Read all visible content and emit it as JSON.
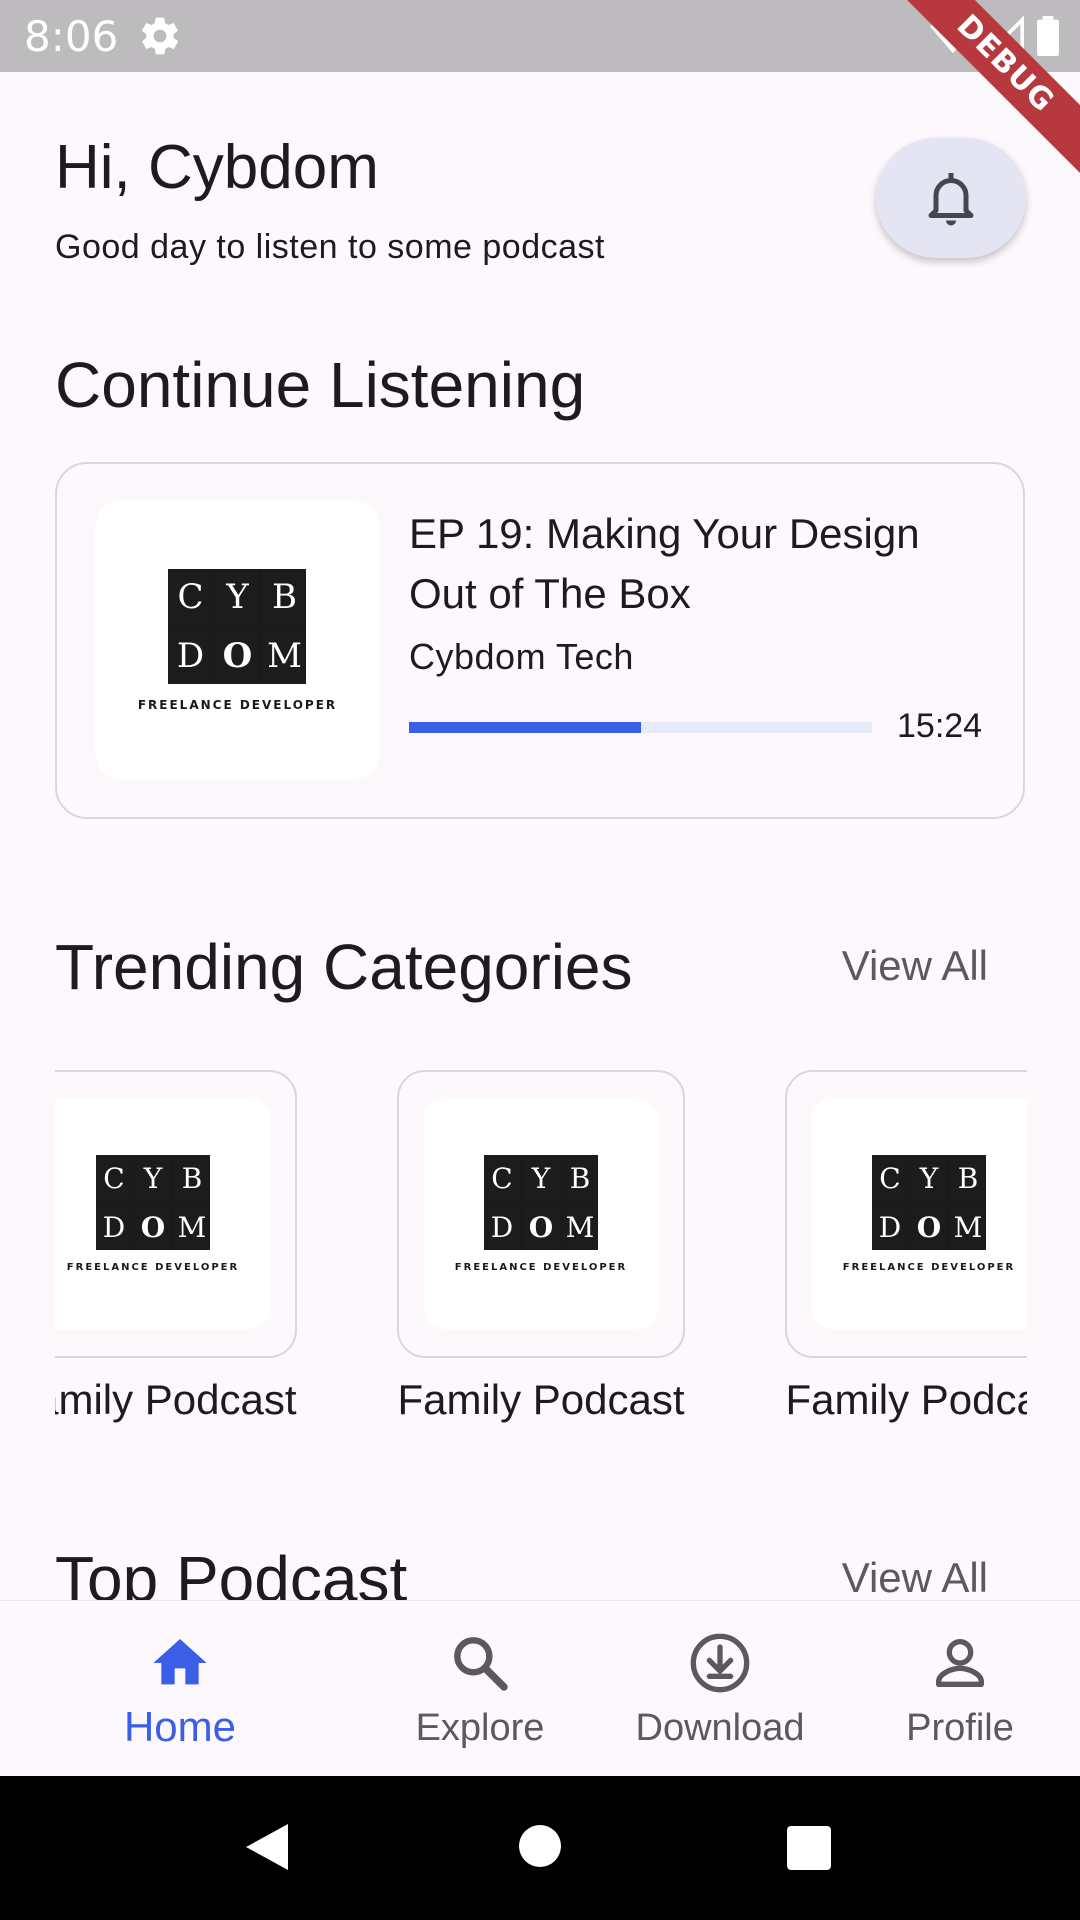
{
  "status_bar": {
    "time": "8:06",
    "debug_label": "DEBUG"
  },
  "header": {
    "greeting": "Hi, Cybdom",
    "subtitle": "Good day to listen to some podcast"
  },
  "continue_listening": {
    "title": "Continue Listening",
    "episode_title": "EP 19: Making Your Design Out of The Box",
    "author": "Cybdom Tech",
    "progress": 0.5,
    "time": "15:24"
  },
  "logo": {
    "cells": [
      "C",
      "Y",
      "B",
      "D",
      "O",
      "M"
    ],
    "subtitle": "FREELANCE DEVELOPER"
  },
  "trending": {
    "title": "Trending Categories",
    "view_all": "View All",
    "items": [
      {
        "label": "Family Podcast"
      },
      {
        "label": "Family Podcast"
      },
      {
        "label": "Family Podcast"
      }
    ]
  },
  "top_podcast": {
    "title": "Top Podcast",
    "view_all": "View All"
  },
  "bottom_nav": {
    "items": [
      {
        "label": "Home",
        "icon": "home-icon",
        "active": true
      },
      {
        "label": "Explore",
        "icon": "search-icon",
        "active": false
      },
      {
        "label": "Download",
        "icon": "download-icon",
        "active": false
      },
      {
        "label": "Profile",
        "icon": "profile-icon",
        "active": false
      }
    ]
  },
  "colors": {
    "accent": "#3a5ee8",
    "background": "#FDF8FC",
    "bell_button": "#e4e4f2",
    "progress_track": "#e6e9f8"
  }
}
